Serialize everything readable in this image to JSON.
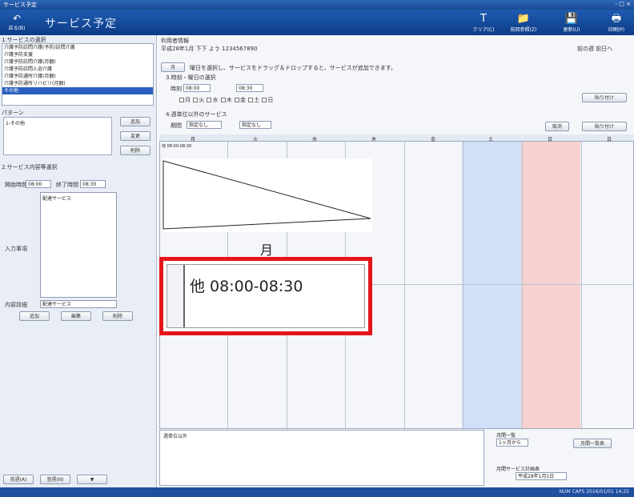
{
  "window": {
    "title": "サービス予定",
    "close": "- □ ×"
  },
  "header": {
    "back_label": "戻る(B)",
    "title": "サービス予定",
    "toolbar": [
      {
        "icon": "clear-icon",
        "label": "クリア(C)"
      },
      {
        "icon": "register-icon",
        "label": "前回参照(Z)"
      },
      {
        "icon": "save-icon",
        "label": "更新(U)"
      },
      {
        "icon": "print-icon",
        "label": "印刷(P)"
      }
    ]
  },
  "left": {
    "section1": "1.サービスの選択",
    "services": [
      "介護予防訪問介護(予防)訪問介護",
      "介護予防支援",
      "介護予防訪問介護(月額)",
      "介護予防訪問入浴介護",
      "介護予防通所介護(月額)",
      "介護予防通所リハビリ(月額)",
      "その他"
    ],
    "section2": "パターン",
    "pattern_item": "1-その他",
    "pattern_buttons": [
      "追加",
      "変更",
      "削除"
    ],
    "section3": "2.サービス内容等選択",
    "time_label": "開始時間",
    "time_from": "08:00",
    "time_to_label": "終了時間",
    "time_to": "08:30",
    "content_label": "サービス内容",
    "content_value": "配達サービス",
    "input_label": "入力事項",
    "bottom_label": "内容詳細",
    "bottom_value": "配達サービス",
    "action_buttons": [
      "追加",
      "編集",
      "削除"
    ],
    "footer_buttons": [
      "前週(A)",
      "翌週(N)",
      "▼"
    ]
  },
  "main": {
    "info_title": "利用者情報",
    "info_line": "平成28年1月  下下 よう  1234567890",
    "top_right": "前の週 前日へ",
    "instructions": "曜日を選択し、サービスをドラッグ＆ドロップすると、サービスが追加できます。",
    "section3": "3.時刻・曜日の選択",
    "time_start_label": "時刻",
    "time_start": "08:00",
    "time_end": "08:30",
    "weekday_checks": [
      "月",
      "火",
      "水",
      "木",
      "金",
      "土",
      "日"
    ],
    "apply_button": "貼り付け",
    "section4": "4.週単位以外のサービス",
    "period_label": "期間",
    "period_value": "指定なし",
    "period_to": "指定なし",
    "clear_button": "取消",
    "apply_button2": "貼り付け",
    "days": [
      "月",
      "火",
      "水",
      "木",
      "金",
      "土",
      "日",
      "日"
    ],
    "cell_entry": "他 08:00-08:30",
    "bottom_left_label": "週単位以外",
    "bottom_right_label1": "月間一覧",
    "bottom_right_value1": "1ヶ月から",
    "bottom_right_button": "月間一覧表",
    "bottom_right_label2": "月間サービス計画表",
    "bottom_right_value2": "平成28年1月1日"
  },
  "zoom": {
    "day": "月",
    "entry": "他 08:00-08:30"
  },
  "status": {
    "right": "NUM  CAPS  2016/01/01 14:25"
  }
}
